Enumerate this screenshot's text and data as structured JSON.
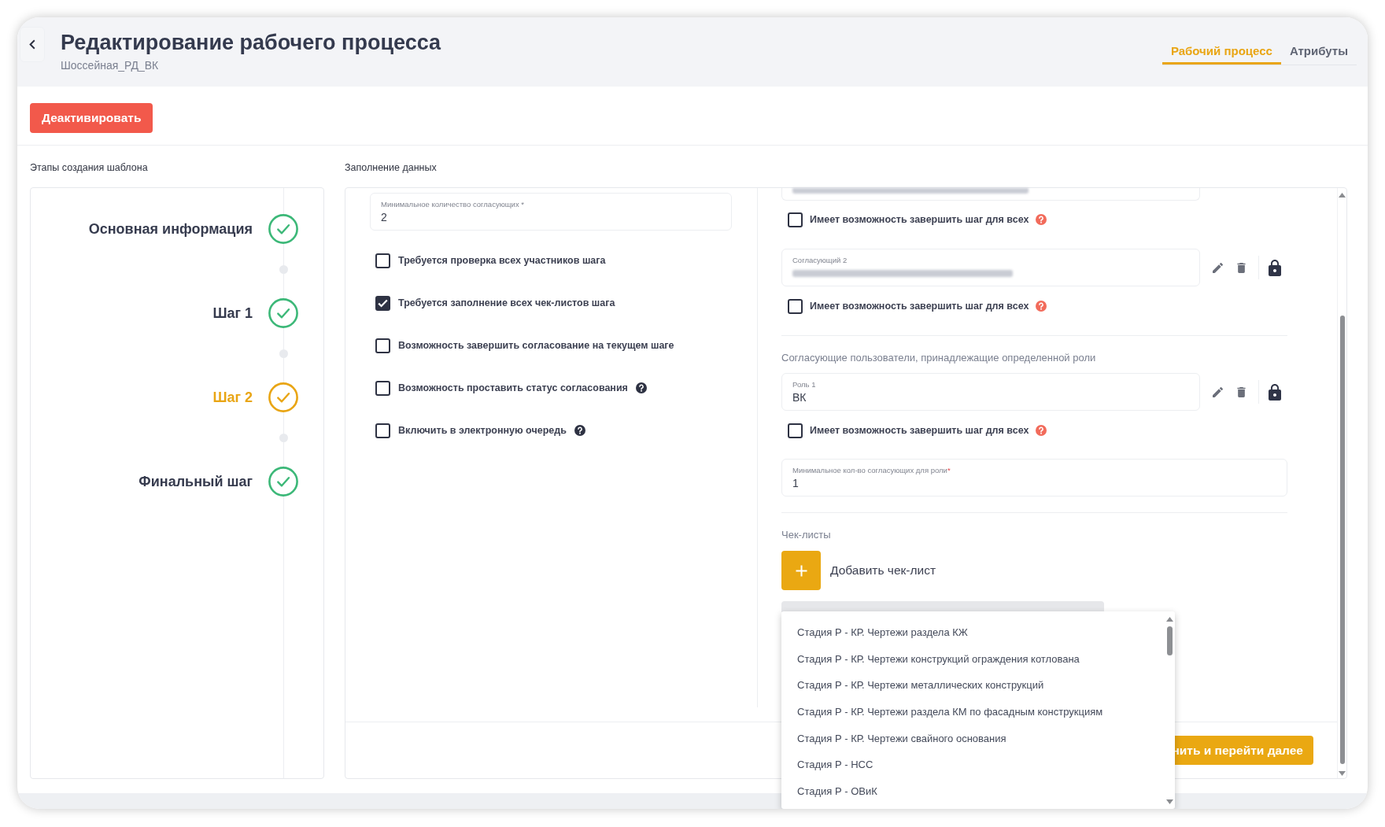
{
  "window": {
    "title": "Редактирование рабочего процесса",
    "subtitle": "Шоссейная_РД_ВК"
  },
  "tabs": [
    {
      "label": "Рабочий процесс",
      "selected": true
    },
    {
      "label": "Атрибуты",
      "selected": false
    }
  ],
  "toolbar": {
    "deactivate_button": "Деактивировать"
  },
  "steps_panel": {
    "title": "Этапы создания шаблона",
    "steps": [
      {
        "label": "Основная информация",
        "selected": false
      },
      {
        "label": "Шаг 1",
        "selected": false
      },
      {
        "label": "Шаг 2",
        "selected": true
      },
      {
        "label": "Финальный шаг",
        "selected": false
      }
    ]
  },
  "form": {
    "title": "Заполнение данных",
    "min_approvers": {
      "label": "Минимальное количество согласующих *",
      "value": "2"
    },
    "options": [
      {
        "label": "Требуется проверка всех участников шага",
        "checked": false,
        "help": false
      },
      {
        "label": "Требуется заполнение всех чек-листов шага",
        "checked": true,
        "help": false
      },
      {
        "label": "Возможность завершить согласование на текущем шаге",
        "checked": false,
        "help": false
      },
      {
        "label": "Возможность проставить статус согласования",
        "checked": false,
        "help": true
      },
      {
        "label": "Включить в электронную очередь",
        "checked": false,
        "help": true
      }
    ],
    "approvers": [
      {
        "kind": "cut_off",
        "redacted": true,
        "option": {
          "label": "Имеет возможность завершить шаг для всех",
          "checked": false,
          "help": true
        }
      },
      {
        "kind": "field",
        "label": "Согласующий 2",
        "redacted": true,
        "option": {
          "label": "Имеет возможность завершить шаг для всех",
          "checked": false,
          "help": true
        }
      }
    ],
    "roles_section": {
      "title": "Согласующие пользователи, принадлежащие определенной роли",
      "roles": [
        {
          "label": "Роль 1",
          "value": "ВК",
          "option": {
            "label": "Имеет возможность завершить шаг для всех",
            "checked": false,
            "help": true
          }
        }
      ],
      "min_for_role": {
        "label": "Минимальное кол-во согласующих для роли",
        "mark": "*",
        "value": "1"
      }
    },
    "checklists": {
      "title": "Чек-листы",
      "add_button": "Добавить чек-лист",
      "dropdown": {
        "options": [
          "Стадия Р - КР. Чертежи раздела КЖ",
          "Стадия Р - КР. Чертежи конструкций ограждения котлована",
          "Стадия Р - КР. Чертежи металлических конструкций",
          "Стадия Р - КР. Чертежи раздела КМ по фасадным конструкциям",
          "Стадия Р - КР. Чертежи свайного основания",
          "Стадия Р - НСС",
          "Стадия Р - ОВиК"
        ]
      }
    },
    "footer": {
      "next_button": "нить и перейти далее"
    }
  }
}
